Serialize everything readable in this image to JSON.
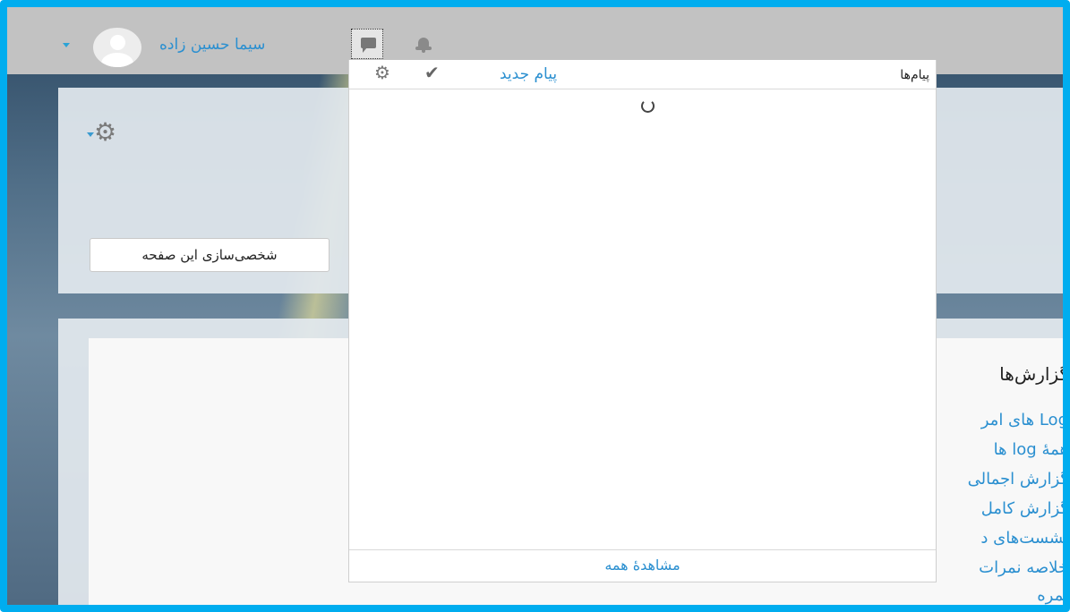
{
  "topbar": {
    "user_name": "سیما حسین زاده"
  },
  "page": {
    "customize_button": "شخصی‌سازی این صفحه",
    "reports": {
      "title": "گزارش‌ها",
      "links": [
        "Log های امر",
        "همهٔ log ها",
        "گزارش اجمالی",
        "گزارش کامل",
        "نشست‌های د",
        "خلاصه نمرات",
        "نمره"
      ]
    }
  },
  "messages_dropdown": {
    "title": "پیام‌ها",
    "new_message": "پیام جدید",
    "see_all": "مشاهدهٔ همه"
  },
  "icons": {
    "user_menu_caret": "caret-down-icon",
    "avatar": "user-avatar-icon",
    "messages": "chat-bubble-icon",
    "notifications": "bell-icon",
    "settings": "gear-icon",
    "mark_all_read": "checkmark-icon",
    "loading": "spinner-icon"
  },
  "colors": {
    "frame_border": "#00adef",
    "link": "#2a8fd0",
    "topbar": "#c2c2c2"
  }
}
